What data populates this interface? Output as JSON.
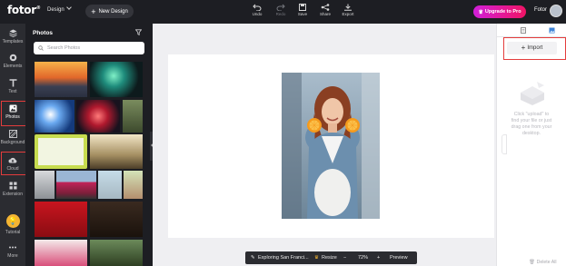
{
  "app": {
    "logo": "fotor",
    "design_menu": "Design",
    "new_design": "New Design"
  },
  "toolbar": {
    "undo": "Undo",
    "redo": "Redo",
    "save": "Save",
    "share": "Share",
    "export": "Export",
    "redo_disabled": true
  },
  "account": {
    "upgrade": "Upgrade to Pro",
    "name": "Fotor"
  },
  "rail": {
    "items": [
      {
        "label": "Templates",
        "icon": "layers-icon"
      },
      {
        "label": "Elements",
        "icon": "elements-icon"
      },
      {
        "label": "Text",
        "icon": "text-icon"
      },
      {
        "label": "Photos",
        "icon": "image-icon",
        "active": true,
        "highlighted": true
      },
      {
        "label": "Background",
        "icon": "background-icon"
      },
      {
        "label": "Cloud",
        "icon": "cloud-upload-icon",
        "highlighted": true
      },
      {
        "label": "Extension",
        "icon": "grid-icon"
      },
      {
        "label": "Tutorial",
        "icon": "lightbulb-icon"
      },
      {
        "label": "More",
        "icon": "dots-icon"
      }
    ]
  },
  "photos_panel": {
    "title": "Photos",
    "search_placeholder": "Search Photos"
  },
  "canvas_bar": {
    "project_name": "Exploring San Franci...",
    "resize": "Resize",
    "zoom_out": "−",
    "zoom": "72%",
    "zoom_in": "+",
    "preview": "Preview"
  },
  "right_panel": {
    "import": "Import",
    "empty_message": "Click \"upload\" to find your file or just drag one from your desktop.",
    "delete_all": "Delete All"
  },
  "colors": {
    "topbar": "#1d1e23",
    "rail": "#2b2c31",
    "upgrade_start": "#d11fd9",
    "upgrade_end": "#f01464",
    "highlight": "#e43c3c"
  }
}
